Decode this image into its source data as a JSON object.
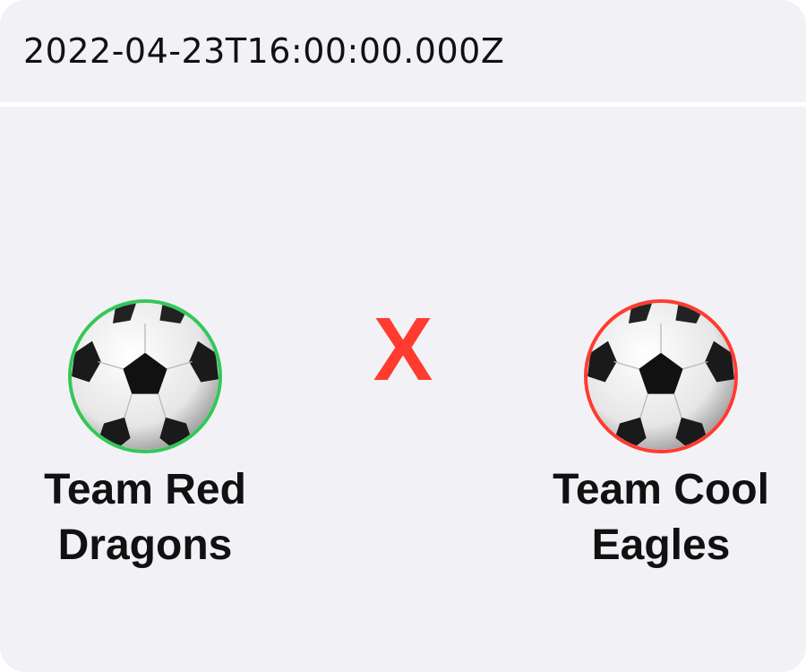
{
  "match": {
    "date": "2022-04-23T16:00:00.000Z",
    "separator": "X",
    "home_team": {
      "name": "Team Red Dragons",
      "icon": "soccer-ball-icon",
      "ring_color": "#34c759"
    },
    "away_team": {
      "name": "Team Cool Eagles",
      "icon": "soccer-ball-icon",
      "ring_color": "#ff3b30"
    }
  },
  "colors": {
    "background": "#f2f2f6",
    "accent": "#ff3b30",
    "winner": "#34c759"
  }
}
